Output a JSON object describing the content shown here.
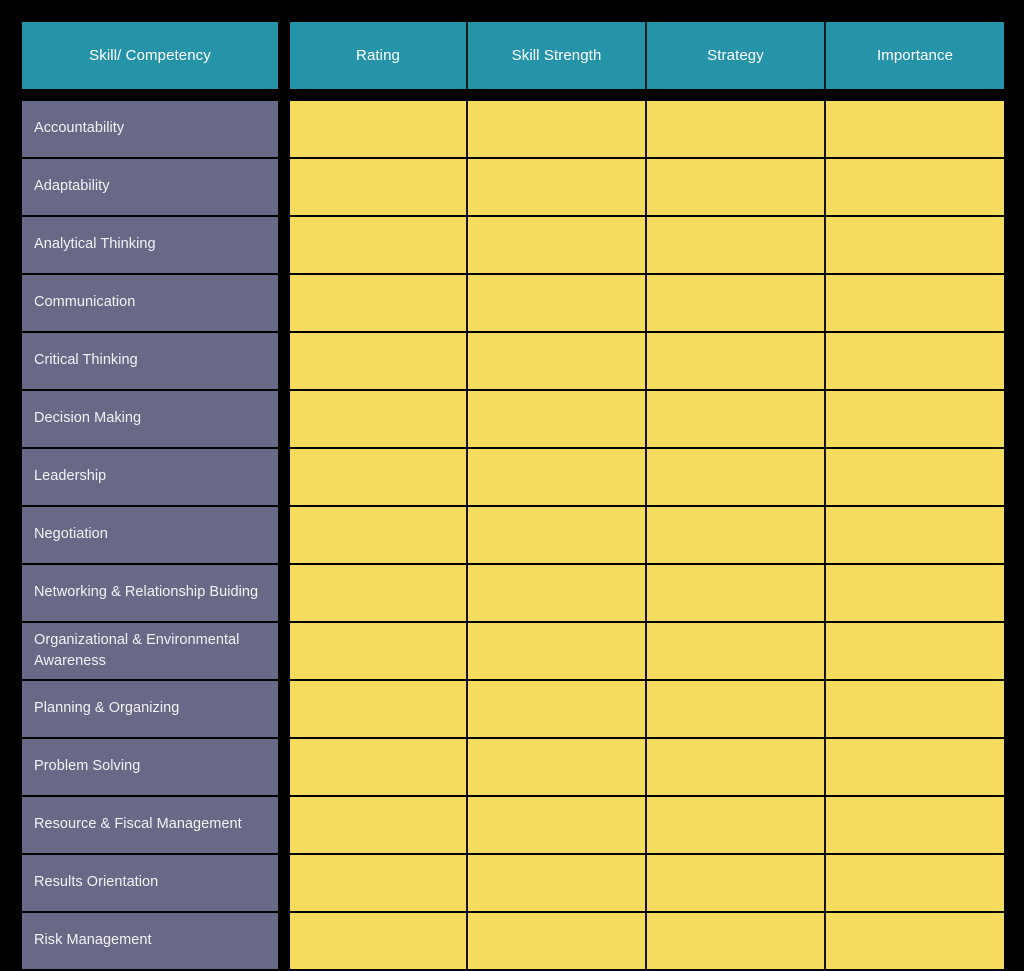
{
  "colors": {
    "background": "#000000",
    "header_teal": "#2593A8",
    "row_purple": "#686887",
    "cell_yellow": "#F5DC5F",
    "header_text": "#FFFFFF",
    "row_text": "#F3F3F5",
    "grid_line": "#141414"
  },
  "table": {
    "columns": [
      {
        "label": "Skill/ Competency",
        "align": "center",
        "kind": "skill"
      },
      {
        "label": "Rating",
        "align": "center",
        "kind": "data"
      },
      {
        "label": "Skill Strength",
        "align": "center",
        "kind": "data"
      },
      {
        "label": "Strategy",
        "align": "center",
        "kind": "data"
      },
      {
        "label": "Importance",
        "align": "center",
        "kind": "data"
      }
    ],
    "rows": [
      {
        "skill": "Accountability",
        "rating": "",
        "skill_strength": "",
        "strategy": "",
        "importance": ""
      },
      {
        "skill": "Adaptability",
        "rating": "",
        "skill_strength": "",
        "strategy": "",
        "importance": ""
      },
      {
        "skill": "Analytical Thinking",
        "rating": "",
        "skill_strength": "",
        "strategy": "",
        "importance": ""
      },
      {
        "skill": "Communication",
        "rating": "",
        "skill_strength": "",
        "strategy": "",
        "importance": ""
      },
      {
        "skill": "Critical Thinking",
        "rating": "",
        "skill_strength": "",
        "strategy": "",
        "importance": ""
      },
      {
        "skill": "Decision Making",
        "rating": "",
        "skill_strength": "",
        "strategy": "",
        "importance": ""
      },
      {
        "skill": "Leadership",
        "rating": "",
        "skill_strength": "",
        "strategy": "",
        "importance": ""
      },
      {
        "skill": "Negotiation",
        "rating": "",
        "skill_strength": "",
        "strategy": "",
        "importance": ""
      },
      {
        "skill": "Networking & Relationship Buiding",
        "rating": "",
        "skill_strength": "",
        "strategy": "",
        "importance": ""
      },
      {
        "skill": "Organizational & Environmental Awareness",
        "rating": "",
        "skill_strength": "",
        "strategy": "",
        "importance": ""
      },
      {
        "skill": "Planning & Organizing",
        "rating": "",
        "skill_strength": "",
        "strategy": "",
        "importance": ""
      },
      {
        "skill": "Problem Solving",
        "rating": "",
        "skill_strength": "",
        "strategy": "",
        "importance": ""
      },
      {
        "skill": "Resource & Fiscal Management",
        "rating": "",
        "skill_strength": "",
        "strategy": "",
        "importance": ""
      },
      {
        "skill": "Results Orientation",
        "rating": "",
        "skill_strength": "",
        "strategy": "",
        "importance": ""
      },
      {
        "skill": "Risk Management",
        "rating": "",
        "skill_strength": "",
        "strategy": "",
        "importance": ""
      }
    ]
  }
}
